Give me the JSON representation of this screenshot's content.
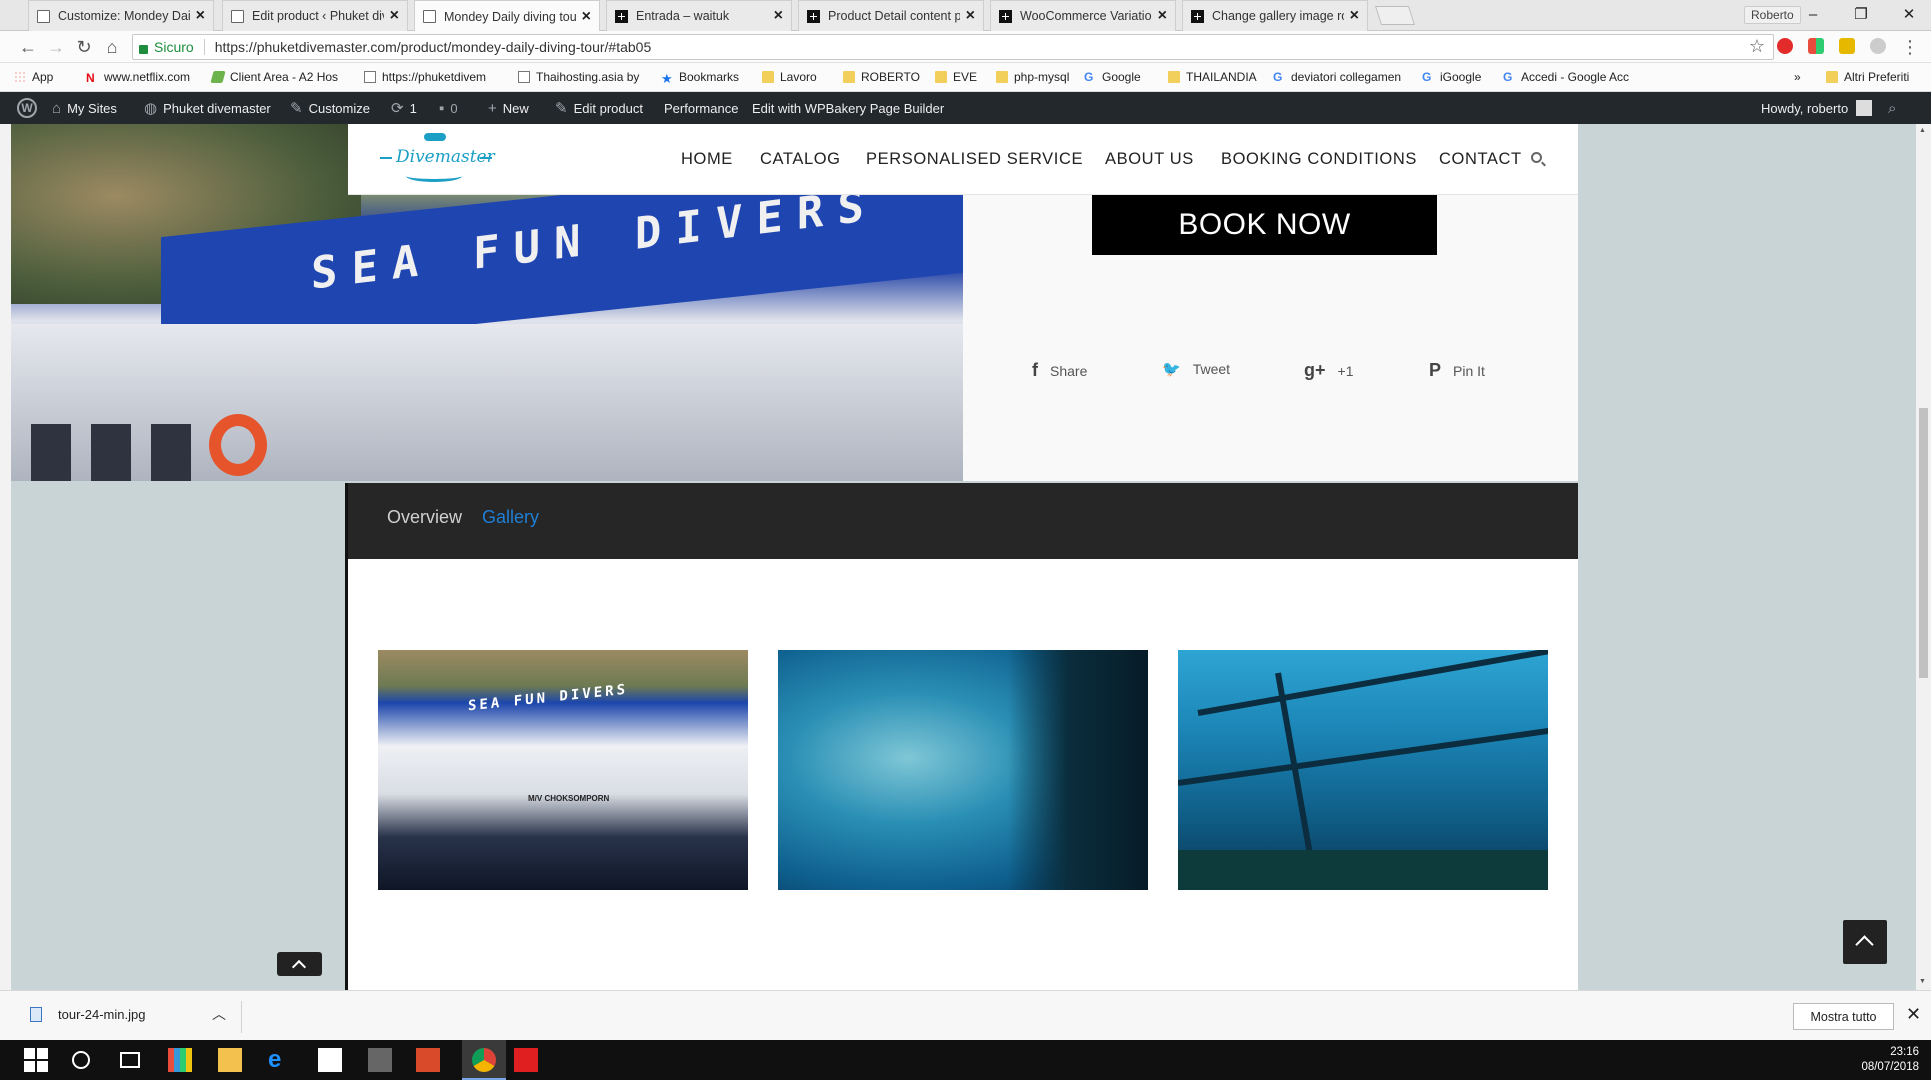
{
  "browser": {
    "tabs": [
      {
        "title": "Customize: Mondey Daily",
        "icon": "doc"
      },
      {
        "title": "Edit product ‹ Phuket div",
        "icon": "doc"
      },
      {
        "title": "Mondey Daily diving tou",
        "icon": "doc",
        "active": true
      },
      {
        "title": "Entrada – waituk",
        "icon": "plus"
      },
      {
        "title": "Product Detail content p",
        "icon": "plus"
      },
      {
        "title": "WooCommerce Variation",
        "icon": "plus"
      },
      {
        "title": "Change gallery image ro",
        "icon": "plus"
      }
    ],
    "profile_name": "Roberto",
    "secure_label": "Sicuro",
    "url": "https://phuketdivemaster.com/product/mondey-daily-diving-tour/#tab05",
    "bookmarks": [
      {
        "label": "App",
        "icon": "app"
      },
      {
        "label": "www.netflix.com",
        "icon": "netflix"
      },
      {
        "label": "Client Area - A2 Hos",
        "icon": "a2"
      },
      {
        "label": "https://phuketdivem",
        "icon": "doc"
      },
      {
        "label": "Thaihosting.asia by",
        "icon": "doc"
      },
      {
        "label": "Bookmarks",
        "icon": "star"
      },
      {
        "label": "Lavoro",
        "icon": "folder"
      },
      {
        "label": "ROBERTO",
        "icon": "folder"
      },
      {
        "label": "EVE",
        "icon": "folder"
      },
      {
        "label": "php-mysql",
        "icon": "folder"
      },
      {
        "label": "Google",
        "icon": "google"
      },
      {
        "label": "THAILANDIA",
        "icon": "folder"
      },
      {
        "label": "deviatori collegamen",
        "icon": "google"
      },
      {
        "label": "iGoogle",
        "icon": "google"
      },
      {
        "label": "Accedi - Google Acc",
        "icon": "google"
      }
    ],
    "bookmarks_overflow": "»",
    "other_bookmarks": "Altri Preferiti"
  },
  "wp_admin_bar": {
    "my_sites": "My Sites",
    "site_name": "Phuket divemaster",
    "customize": "Customize",
    "updates_count": "1",
    "comments_count": "0",
    "new_label": "New",
    "edit_product": "Edit product",
    "performance": "Performance",
    "wpbakery": "Edit with WPBakery Page Builder",
    "howdy": "Howdy, roberto"
  },
  "site": {
    "logo_text": "Divemaster",
    "hero_boat_text": "SEA FUN DIVERS",
    "nav": [
      "HOME",
      "CATALOG",
      "PERSONALISED SERVICE",
      "ABOUT US",
      "BOOKING CONDITIONS",
      "CONTACT"
    ],
    "book_now": "BOOK NOW",
    "share_buttons": [
      {
        "icon": "facebook-icon",
        "glyph": "f",
        "label": "Share"
      },
      {
        "icon": "twitter-icon",
        "glyph": "🐦",
        "label": "Tweet"
      },
      {
        "icon": "google-plus-icon",
        "glyph": "g+",
        "label": "+1"
      },
      {
        "icon": "pinterest-icon",
        "glyph": "P",
        "label": "Pin It"
      }
    ],
    "product_tabs": [
      {
        "label": "Overview",
        "active": false
      },
      {
        "label": "Gallery",
        "active": true
      }
    ],
    "gallery": [
      {
        "name": "boat-photo",
        "caption_boat": "SEA FUN DIVERS",
        "caption_hull": "M/V CHOKSOMPORN"
      },
      {
        "name": "fish-school-photo"
      },
      {
        "name": "wreck-photo"
      }
    ]
  },
  "downloads": {
    "file_name": "tour-24-min.jpg",
    "show_all": "Mostra tutto"
  },
  "taskbar": {
    "time": "23:16",
    "date": "08/07/2018"
  },
  "colors": {
    "active_tab_text": "#1e7fd6",
    "inactive_tab_text": "#d0d0d0",
    "accent_blue": "#1b9fc5",
    "wp_bar": "#23282d"
  }
}
